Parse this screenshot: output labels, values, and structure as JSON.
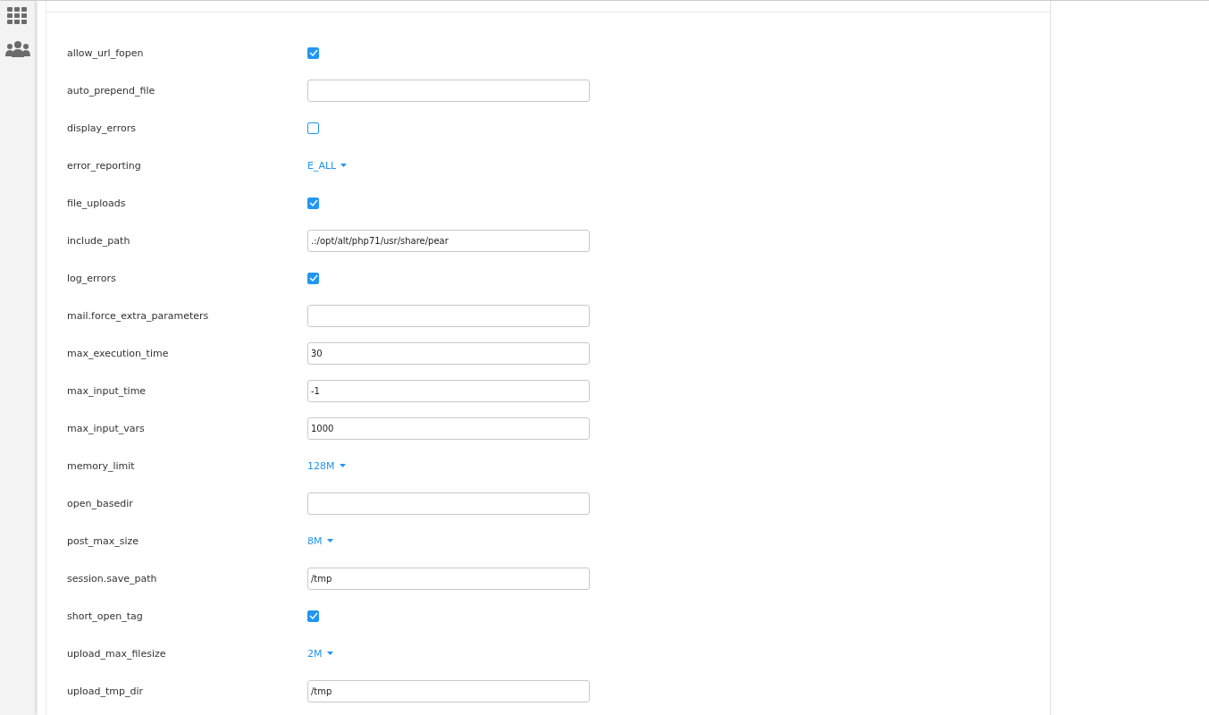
{
  "settings": [
    {
      "name": "allow_url_fopen",
      "kind": "checkbox",
      "checked": true
    },
    {
      "name": "auto_prepend_file",
      "kind": "text"
    },
    {
      "name": "display_errors",
      "kind": "checkbox",
      "checked": false
    },
    {
      "name": "error_reporting",
      "kind": "dropdown",
      "value": "E_ALL"
    },
    {
      "name": "file_uploads",
      "kind": "checkbox",
      "checked": true
    },
    {
      "name": "include_path",
      "kind": "text",
      "value": ".:/opt/alt/php71/usr/share/pear"
    },
    {
      "name": "log_errors",
      "kind": "checkbox",
      "checked": true
    },
    {
      "name": "mail.force_extra_parameters",
      "kind": "text"
    },
    {
      "name": "max_execution_time",
      "kind": "text",
      "value": "30"
    },
    {
      "name": "max_input_time",
      "kind": "text",
      "value": "-1"
    },
    {
      "name": "max_input_vars",
      "kind": "text",
      "value": "1000"
    },
    {
      "name": "memory_limit",
      "kind": "dropdown",
      "value": "128M"
    },
    {
      "name": "open_basedir",
      "kind": "text"
    },
    {
      "name": "post_max_size",
      "kind": "dropdown",
      "value": "8M"
    },
    {
      "name": "session.save_path",
      "kind": "text",
      "value": "/tmp"
    },
    {
      "name": "short_open_tag",
      "kind": "checkbox",
      "checked": true
    },
    {
      "name": "upload_max_filesize",
      "kind": "dropdown",
      "value": "2M"
    },
    {
      "name": "upload_tmp_dir",
      "kind": "text",
      "value": "/tmp"
    }
  ]
}
